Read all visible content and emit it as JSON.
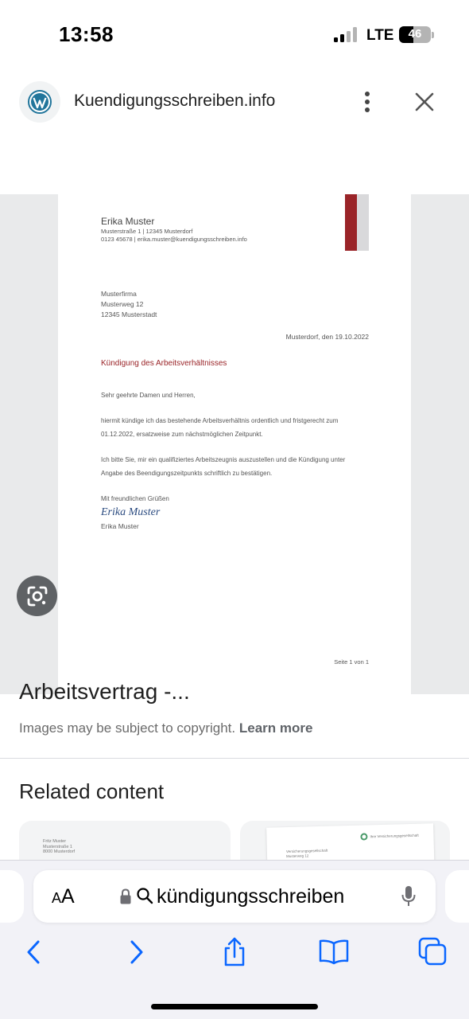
{
  "status_bar": {
    "time": "13:58",
    "network": "LTE",
    "battery_level": "46",
    "signal_bars_active": 2,
    "signal_bars_total": 4
  },
  "site": {
    "favicon": "wordpress-icon",
    "name": "Kuendigungsschreiben.info",
    "more_icon": "more-vert-icon",
    "close_icon": "close-icon"
  },
  "document": {
    "sender_name": "Erika Muster",
    "sender_address": "Musterstraße 1 | 12345 Musterdorf",
    "sender_contact": "0123 45678 | erika.muster@kuendigungsschreiben.info",
    "recipient_lines": [
      "Musterfirma",
      "Musterweg 12",
      "12345 Musterstadt"
    ],
    "date_line": "Musterdorf, den 19.10.2022",
    "subject": "Kündigung des Arbeitsverhältnisses",
    "salutation": "Sehr geehrte Damen und Herren,",
    "paragraph1_lines": [
      "hiermit kündige ich das bestehende Arbeitsverhältnis ordentlich und fristgerecht zum",
      "01.12.2022, ersatzweise zum nächstmöglichen Zeitpunkt."
    ],
    "paragraph2_lines": [
      "Ich bitte Sie, mir ein qualifiziertes Arbeitszeugnis auszustellen und die Kündigung unter",
      "Angabe des Beendigungszeitpunkts schriftlich zu bestätigen."
    ],
    "closing": "Mit freundlichen Grüßen",
    "signature": "Erika Muster",
    "signed_name": "Erika Muster",
    "page_number": "Seite 1 von 1",
    "accent_color": "#9a2428"
  },
  "lens_button_icon": "google-lens-icon",
  "result_title": "Arbeitsvertrag -...",
  "copyright": {
    "text": "Images may be subject to copyright.",
    "link": "Learn more"
  },
  "related": {
    "heading": "Related content",
    "cards": [
      {
        "lines": [
          "Fritz Muster",
          "Musterstraße 1",
          "8000 Musterdorf"
        ]
      },
      {
        "lines": [
          "Versicherungsgesellschaft",
          "Musterweg 12"
        ],
        "logo_text": "Ihre Versicherungsgesellschaft"
      }
    ]
  },
  "browser": {
    "text_size_label": "AA",
    "url_text": "kündigungsschreiben",
    "toolbar_icons": [
      "back-icon",
      "forward-icon",
      "share-icon",
      "bookmarks-icon",
      "tabs-icon"
    ],
    "accent_color": "#0a66ff"
  }
}
